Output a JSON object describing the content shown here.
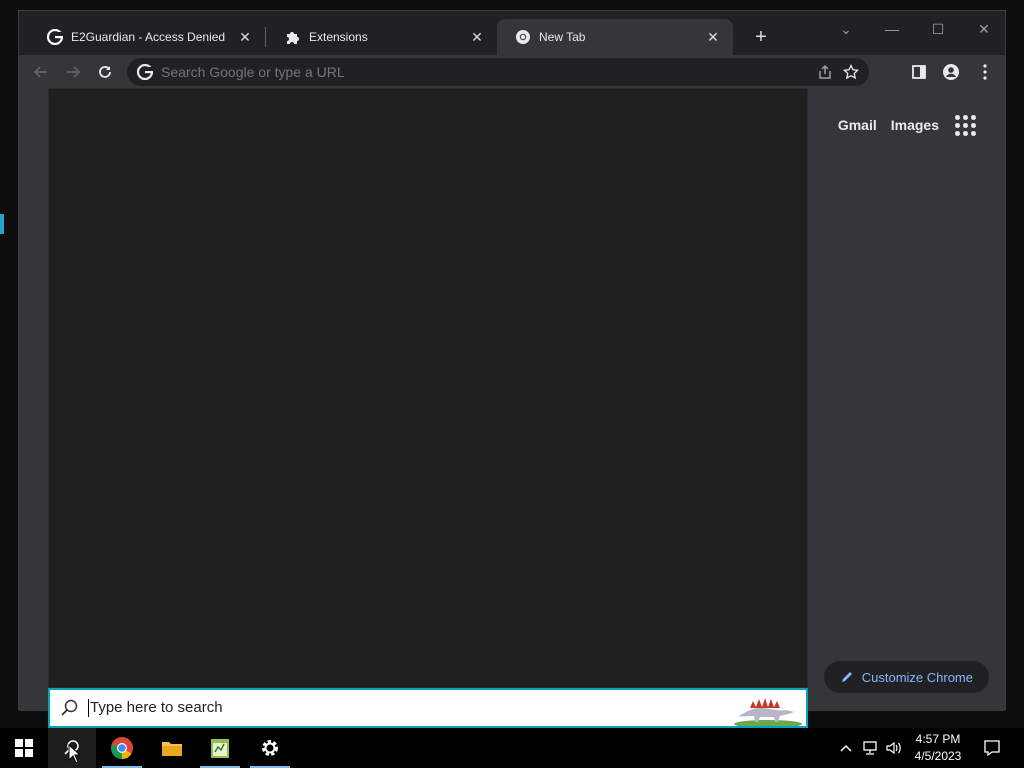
{
  "browser": {
    "tabs": [
      {
        "title": "E2Guardian - Access Denied",
        "favicon": "google-g-icon",
        "close": "✕"
      },
      {
        "title": "Extensions",
        "favicon": "puzzle-icon",
        "close": "✕"
      },
      {
        "title": "New Tab",
        "favicon": "chrome-icon",
        "close": "✕",
        "active": true
      }
    ],
    "new_tab_symbol": "+",
    "window_controls": {
      "minimize": "—",
      "maximize": "☐",
      "close": "✕",
      "dropdown": "⌄"
    },
    "omnibox_placeholder": "Search Google or type a URL",
    "ntp": {
      "gmail": "Gmail",
      "images": "Images",
      "customize_label": "Customize Chrome"
    }
  },
  "search": {
    "placeholder": "Type here to search"
  },
  "taskbar": {
    "time": "4:57 PM",
    "date": "4/5/2023",
    "apps": [
      "start-icon",
      "search-icon",
      "chrome-icon",
      "file-explorer-icon",
      "notepad-icon",
      "settings-gear-icon"
    ]
  },
  "colors": {
    "accent": "#0aa2b8",
    "link": "#8ab4f8",
    "taskbar_running": "#76b9ed"
  }
}
